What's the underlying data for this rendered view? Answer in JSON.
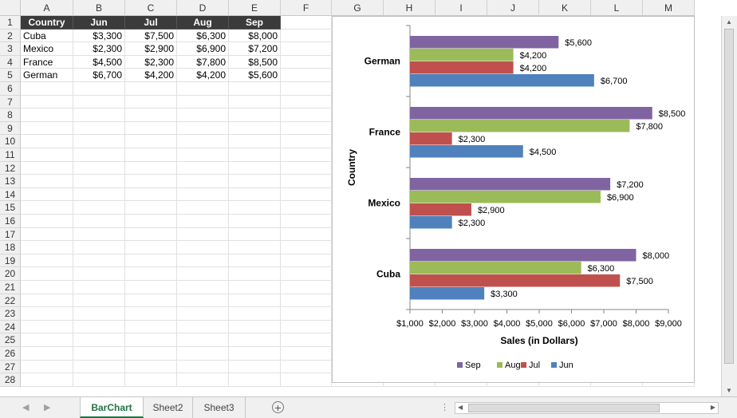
{
  "columns": [
    "A",
    "B",
    "C",
    "D",
    "E",
    "F",
    "G",
    "H",
    "I",
    "J",
    "K",
    "L",
    "M"
  ],
  "rows": [
    "1",
    "2",
    "3",
    "4",
    "5",
    "6",
    "7",
    "8",
    "9",
    "10",
    "11",
    "12",
    "13",
    "14",
    "15",
    "16",
    "17",
    "18",
    "19",
    "20",
    "21",
    "22",
    "23",
    "24",
    "25",
    "26",
    "27",
    "28"
  ],
  "table": {
    "headers": [
      "Country",
      "Jun",
      "Jul",
      "Aug",
      "Sep"
    ],
    "rows": [
      [
        "Cuba",
        "$3,300",
        "$7,500",
        "$6,300",
        "$8,000"
      ],
      [
        "Mexico",
        "$2,300",
        "$2,900",
        "$6,900",
        "$7,200"
      ],
      [
        "France",
        "$4,500",
        "$2,300",
        "$7,800",
        "$8,500"
      ],
      [
        "German",
        "$6,700",
        "$4,200",
        "$4,200",
        "$5,600"
      ]
    ]
  },
  "chart_data": {
    "type": "bar",
    "orientation": "horizontal",
    "categories": [
      "Cuba",
      "Mexico",
      "France",
      "German"
    ],
    "series": [
      {
        "name": "Jun",
        "color": "#4f81bd",
        "values": [
          3300,
          2300,
          4500,
          6700
        ],
        "labels": [
          "$3,300",
          "$2,300",
          "$4,500",
          "$6,700"
        ]
      },
      {
        "name": "Jul",
        "color": "#c0504d",
        "values": [
          7500,
          2900,
          2300,
          4200
        ],
        "labels": [
          "$7,500",
          "$2,900",
          "$2,300",
          "$4,200"
        ]
      },
      {
        "name": "Aug",
        "color": "#9bbb59",
        "values": [
          6300,
          6900,
          7800,
          4200
        ],
        "labels": [
          "$6,300",
          "$6,900",
          "$7,800",
          "$4,200"
        ]
      },
      {
        "name": "Sep",
        "color": "#8064a2",
        "values": [
          8000,
          7200,
          8500,
          5600
        ],
        "labels": [
          "$8,000",
          "$7,200",
          "$8,500",
          "$5,600"
        ]
      }
    ],
    "xlim": [
      1000,
      9000
    ],
    "xticks": [
      "$1,000",
      "$2,000",
      "$3,000",
      "$4,000",
      "$5,000",
      "$6,000",
      "$7,000",
      "$8,000",
      "$9,000"
    ],
    "xlabel": "Sales (in Dollars)",
    "ylabel": "Country",
    "legend": [
      "Sep",
      "Aug",
      "Jul",
      "Jun"
    ],
    "legend_position": "bottom",
    "grid": false
  },
  "sheets": [
    "BarChart",
    "Sheet2",
    "Sheet3"
  ],
  "active_sheet": "BarChart",
  "add_sheet_symbol": "+"
}
